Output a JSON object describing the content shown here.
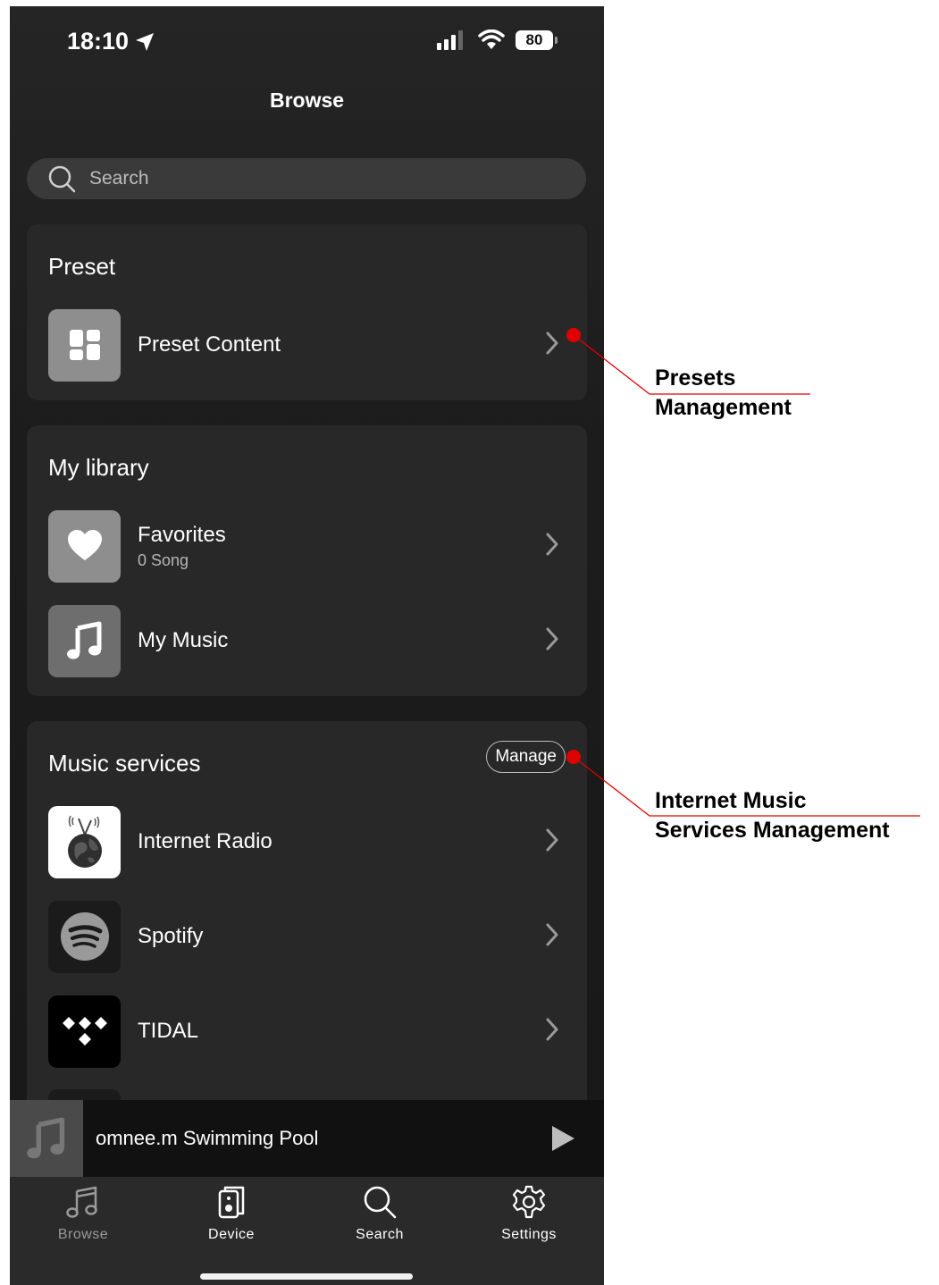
{
  "status": {
    "time": "18:10",
    "battery": "80",
    "location_icon": "location-arrow-icon",
    "signal_icon": "cellular-signal-icon",
    "wifi_icon": "wifi-icon"
  },
  "header": {
    "title": "Browse"
  },
  "search": {
    "placeholder": "Search",
    "icon": "search-icon"
  },
  "sections": {
    "preset": {
      "title": "Preset",
      "items": [
        {
          "label": "Preset Content",
          "icon": "grid-tiles-icon"
        }
      ]
    },
    "library": {
      "title": "My library",
      "items": [
        {
          "label": "Favorites",
          "subtitle": "0 Song",
          "icon": "heart-icon"
        },
        {
          "label": "My Music",
          "icon": "music-note-icon"
        }
      ]
    },
    "services": {
      "title": "Music services",
      "manage_label": "Manage",
      "items": [
        {
          "label": "Internet Radio",
          "icon": "globe-radio-icon"
        },
        {
          "label": "Spotify",
          "icon": "spotify-logo-icon"
        },
        {
          "label": "TIDAL",
          "icon": "tidal-logo-icon"
        }
      ]
    }
  },
  "now_playing": {
    "title": "omnee.m Swimming Pool",
    "play_icon": "play-icon"
  },
  "tabs": [
    {
      "label": "Browse",
      "icon": "music-note-icon",
      "active": true
    },
    {
      "label": "Device",
      "icon": "speaker-icon"
    },
    {
      "label": "Search",
      "icon": "search-icon"
    },
    {
      "label": "Settings",
      "icon": "gear-icon"
    }
  ],
  "annotations": {
    "presets": [
      "Presets",
      "Management"
    ],
    "services": [
      "Internet Music",
      "Services Management"
    ],
    "color": "#e00000"
  },
  "colors": {
    "background": "#1c1c1c",
    "card": "#282828",
    "accent_red": "#e00000"
  }
}
